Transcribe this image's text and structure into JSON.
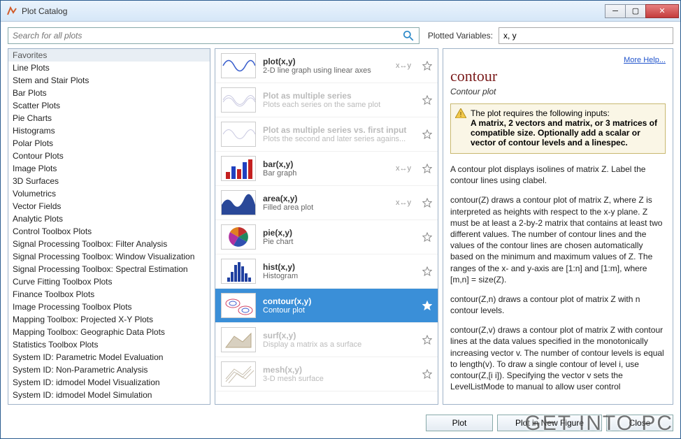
{
  "window": {
    "title": "Plot Catalog"
  },
  "search": {
    "placeholder": "Search for all plots"
  },
  "plotted_vars": {
    "label": "Plotted Variables:",
    "value": "x, y"
  },
  "categories": [
    "Favorites",
    "Line Plots",
    "Stem and Stair Plots",
    "Bar Plots",
    "Scatter Plots",
    "Pie Charts",
    "Histograms",
    "Polar Plots",
    "Contour Plots",
    "Image Plots",
    "3D Surfaces",
    "Volumetrics",
    "Vector Fields",
    "Analytic Plots",
    "Control Toolbox Plots",
    "Signal Processing Toolbox: Filter Analysis",
    "Signal Processing Toolbox: Window Visualization",
    "Signal Processing Toolbox: Spectral Estimation",
    "Curve Fitting Toolbox Plots",
    "Finance Toolbox Plots",
    "Image Processing Toolbox Plots",
    "Mapping Toolbox: Projected X-Y Plots",
    "Mapping Toolbox: Geographic Data Plots",
    "Statistics Toolbox Plots",
    "System ID: Parametric Model Evaluation",
    "System ID: Non-Parametric Analysis",
    "System ID: idmodel Model Visualization",
    "System ID: idmodel Model Simulation"
  ],
  "plots": [
    {
      "title": "plot(x,y)",
      "desc": "2-D line graph using linear axes",
      "arrow": "x↔y",
      "dim": false,
      "sel": false
    },
    {
      "title": "Plot as multiple series",
      "desc": "Plots each series on the same plot",
      "arrow": "",
      "dim": true,
      "sel": false
    },
    {
      "title": "Plot as multiple series vs. first input",
      "desc": "Plots the second and later series agains...",
      "arrow": "",
      "dim": true,
      "sel": false
    },
    {
      "title": "bar(x,y)",
      "desc": "Bar graph",
      "arrow": "x↔y",
      "dim": false,
      "sel": false
    },
    {
      "title": "area(x,y)",
      "desc": "Filled area plot",
      "arrow": "x↔y",
      "dim": false,
      "sel": false
    },
    {
      "title": "pie(x,y)",
      "desc": "Pie chart",
      "arrow": "",
      "dim": false,
      "sel": false
    },
    {
      "title": "hist(x,y)",
      "desc": "Histogram",
      "arrow": "",
      "dim": false,
      "sel": false
    },
    {
      "title": "contour(x,y)",
      "desc": "Contour plot",
      "arrow": "",
      "dim": false,
      "sel": true
    },
    {
      "title": "surf(x,y)",
      "desc": "Display a matrix as a surface",
      "arrow": "",
      "dim": true,
      "sel": false
    },
    {
      "title": "mesh(x,y)",
      "desc": "3-D mesh surface",
      "arrow": "",
      "dim": true,
      "sel": false
    }
  ],
  "help": {
    "more_link": "More Help...",
    "name": "contour",
    "sub": "Contour plot",
    "warn_lead": "The plot requires the following inputs:",
    "warn_body": "A matrix, 2 vectors and matrix, or 3 matrices of compatible size. Optionally add a scalar or vector of contour levels and a linespec.",
    "p1": "A contour plot displays isolines of matrix Z. Label the contour lines using clabel.",
    "p2": "contour(Z) draws a contour plot of matrix Z, where Z is interpreted as heights with respect to the x-y plane. Z must be at least a 2-by-2 matrix that contains at least two different values. The number of contour lines and the values of the contour lines are chosen automatically based on the minimum and maximum values of Z. The ranges of the x- and y-axis are [1:n] and [1:m], where [m,n] = size(Z).",
    "p3": "contour(Z,n) draws a contour plot of matrix Z with n contour levels.",
    "p4": "contour(Z,v) draws a contour plot of matrix Z with contour lines at the data values specified in the monotonically increasing vector v. The number of contour levels is equal to length(v). To draw a single contour of level i, use contour(Z,[i i]). Specifying the vector v sets the LevelListMode to manual to allow user control"
  },
  "buttons": {
    "plot": "Plot",
    "plot_new": "Plot in New Figure",
    "close": "Close"
  },
  "watermark": "GET INTO PC"
}
